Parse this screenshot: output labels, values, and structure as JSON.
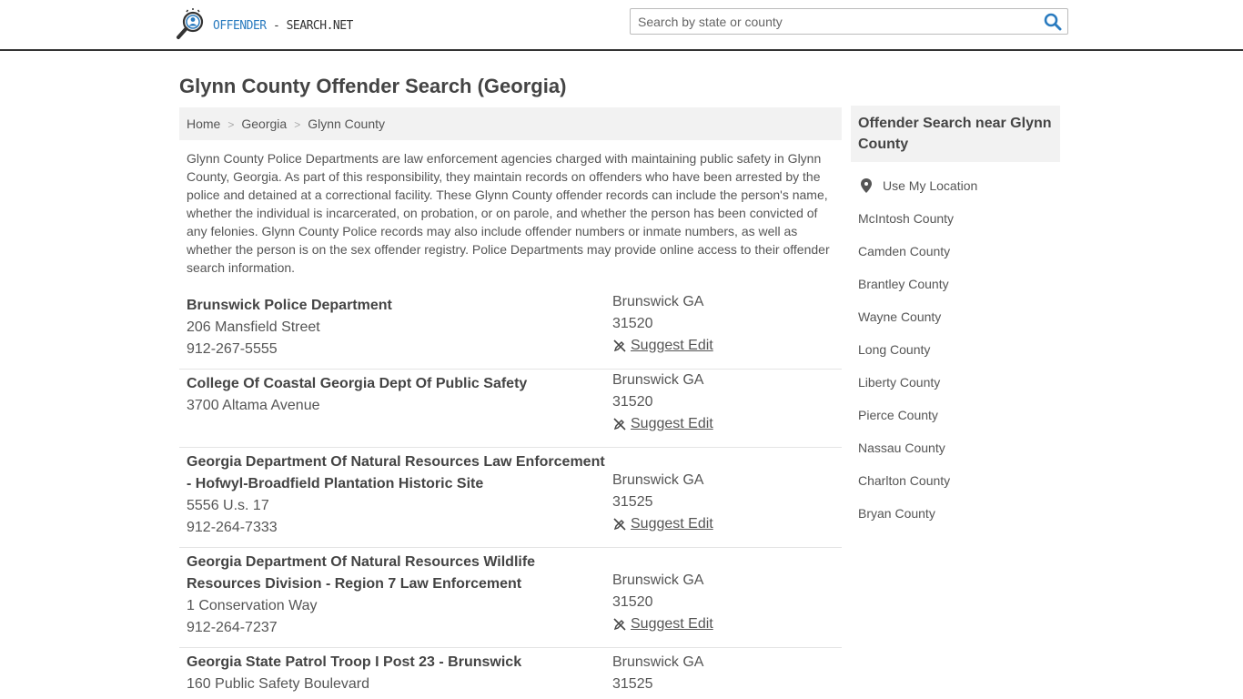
{
  "header": {
    "logo_part1": "OFFENDER",
    "logo_part2": " - SEARCH.NET",
    "search_placeholder": "Search by state or county",
    "colors": {
      "brand_blue": "#2a7bbf",
      "header_border": "#333333"
    }
  },
  "page": {
    "title": "Glynn County Offender Search (Georgia)"
  },
  "breadcrumb": [
    "Home",
    "Georgia",
    "Glynn County"
  ],
  "intro": "Glynn County Police Departments are law enforcement agencies charged with maintaining public safety in Glynn County, Georgia. As part of this responsibility, they maintain records on offenders who have been arrested by the police and detained at a correctional facility. These Glynn County offender records can include the person's name, whether the individual is incarcerated, on probation, or on parole, and whether the person has been convicted of any felonies. Glynn County Police records may also include offender numbers or inmate numbers, as well as whether the person is on the sex offender registry. Police Departments may provide online access to their offender search information.",
  "listings": [
    {
      "name": "Brunswick Police Department",
      "address": "206 Mansfield Street",
      "phone": "912-267-5555",
      "city": "Brunswick GA",
      "zip": "31520",
      "edit": "Suggest Edit"
    },
    {
      "name": "College Of Coastal Georgia Dept Of Public Safety",
      "address": "3700 Altama Avenue",
      "phone": "",
      "city": "Brunswick GA",
      "zip": "31520",
      "edit": "Suggest Edit"
    },
    {
      "name": "Georgia Department Of Natural Resources Law Enforcement - Hofwyl-Broadfield Plantation Historic Site",
      "address": "5556 U.s. 17",
      "phone": "912-264-7333",
      "city": "Brunswick GA",
      "zip": "31525",
      "edit": "Suggest Edit"
    },
    {
      "name": "Georgia Department Of Natural Resources Wildlife Resources Division - Region 7 Law Enforcement",
      "address": "1 Conservation Way",
      "phone": "912-264-7237",
      "city": "Brunswick GA",
      "zip": "31520",
      "edit": "Suggest Edit"
    },
    {
      "name": "Georgia State Patrol Troop I Post 23 - Brunswick",
      "address": "160 Public Safety Boulevard",
      "phone": "",
      "city": "Brunswick GA",
      "zip": "31525",
      "edit": ""
    }
  ],
  "sidebar": {
    "heading": "Offender Search near Glynn County",
    "location_label": "Use My Location",
    "counties": [
      "McIntosh County",
      "Camden County",
      "Brantley County",
      "Wayne County",
      "Long County",
      "Liberty County",
      "Pierce County",
      "Nassau County",
      "Charlton County",
      "Bryan County"
    ]
  }
}
